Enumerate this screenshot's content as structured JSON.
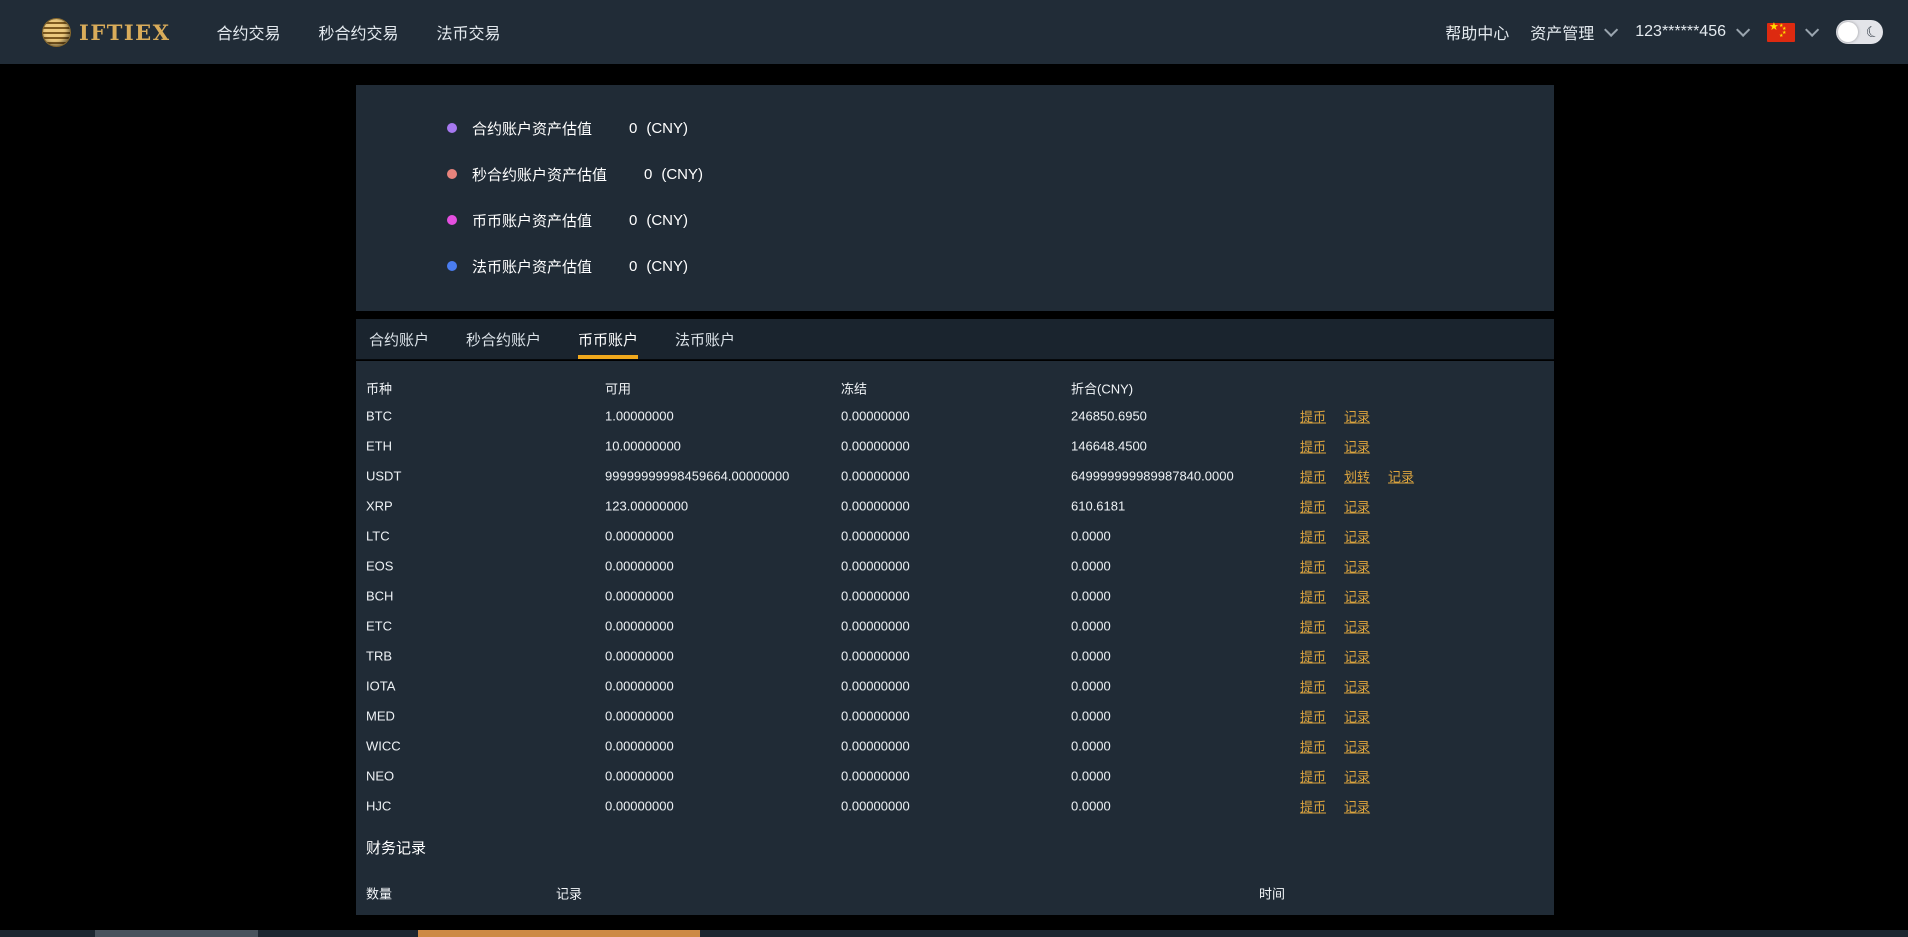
{
  "navbar": {
    "brand": "IFTIEX",
    "items": [
      {
        "label": "合约交易"
      },
      {
        "label": "秒合约交易"
      },
      {
        "label": "法币交易"
      }
    ],
    "right": {
      "help": "帮助中心",
      "assets": "资产管理",
      "account": "123******456"
    }
  },
  "summary": {
    "items": [
      {
        "label": "合约账户资产估值",
        "value": "0",
        "unit": "(CNY)",
        "color": "#a678f0"
      },
      {
        "label": "秒合约账户资产估值",
        "value": "0",
        "unit": "(CNY)",
        "color": "#e8837c"
      },
      {
        "label": "币币账户资产估值",
        "value": "0",
        "unit": "(CNY)",
        "color": "#e44fe0"
      },
      {
        "label": "法币账户资产估值",
        "value": "0",
        "unit": "(CNY)",
        "color": "#4a7df0"
      }
    ]
  },
  "tabs": [
    {
      "label": "合约账户",
      "active": false
    },
    {
      "label": "秒合约账户",
      "active": false
    },
    {
      "label": "币币账户",
      "active": true
    },
    {
      "label": "法币账户",
      "active": false
    }
  ],
  "wallet_table": {
    "headers": [
      "币种",
      "可用",
      "冻结",
      "折合(CNY)"
    ],
    "action_labels": {
      "withdraw": "提币",
      "transfer": "划转",
      "record": "记录"
    },
    "rows": [
      {
        "coin": "BTC",
        "available": "1.00000000",
        "frozen": "0.00000000",
        "cny": "246850.6950",
        "actions": [
          "withdraw",
          "record"
        ]
      },
      {
        "coin": "ETH",
        "available": "10.00000000",
        "frozen": "0.00000000",
        "cny": "146648.4500",
        "actions": [
          "withdraw",
          "record"
        ]
      },
      {
        "coin": "USDT",
        "available": "99999999998459664.00000000",
        "frozen": "0.00000000",
        "cny": "649999999989987840.0000",
        "actions": [
          "withdraw",
          "transfer",
          "record"
        ]
      },
      {
        "coin": "XRP",
        "available": "123.00000000",
        "frozen": "0.00000000",
        "cny": "610.6181",
        "actions": [
          "withdraw",
          "record"
        ]
      },
      {
        "coin": "LTC",
        "available": "0.00000000",
        "frozen": "0.00000000",
        "cny": "0.0000",
        "actions": [
          "withdraw",
          "record"
        ]
      },
      {
        "coin": "EOS",
        "available": "0.00000000",
        "frozen": "0.00000000",
        "cny": "0.0000",
        "actions": [
          "withdraw",
          "record"
        ]
      },
      {
        "coin": "BCH",
        "available": "0.00000000",
        "frozen": "0.00000000",
        "cny": "0.0000",
        "actions": [
          "withdraw",
          "record"
        ]
      },
      {
        "coin": "ETC",
        "available": "0.00000000",
        "frozen": "0.00000000",
        "cny": "0.0000",
        "actions": [
          "withdraw",
          "record"
        ]
      },
      {
        "coin": "TRB",
        "available": "0.00000000",
        "frozen": "0.00000000",
        "cny": "0.0000",
        "actions": [
          "withdraw",
          "record"
        ]
      },
      {
        "coin": "IOTA",
        "available": "0.00000000",
        "frozen": "0.00000000",
        "cny": "0.0000",
        "actions": [
          "withdraw",
          "record"
        ]
      },
      {
        "coin": "MED",
        "available": "0.00000000",
        "frozen": "0.00000000",
        "cny": "0.0000",
        "actions": [
          "withdraw",
          "record"
        ]
      },
      {
        "coin": "WICC",
        "available": "0.00000000",
        "frozen": "0.00000000",
        "cny": "0.0000",
        "actions": [
          "withdraw",
          "record"
        ]
      },
      {
        "coin": "NEO",
        "available": "0.00000000",
        "frozen": "0.00000000",
        "cny": "0.0000",
        "actions": [
          "withdraw",
          "record"
        ]
      },
      {
        "coin": "HJC",
        "available": "0.00000000",
        "frozen": "0.00000000",
        "cny": "0.0000",
        "actions": [
          "withdraw",
          "record"
        ]
      }
    ]
  },
  "finance": {
    "title": "财务记录",
    "headers": [
      "数量",
      "记录",
      "时间"
    ]
  },
  "colors": {
    "accent_gold_underline": "#f0a81c",
    "link_gold": "#dca43e",
    "panel_bg": "#202b36",
    "navbar_bg": "#212c37",
    "page_bg": "#000000",
    "flag_red": "#dd2a10"
  }
}
